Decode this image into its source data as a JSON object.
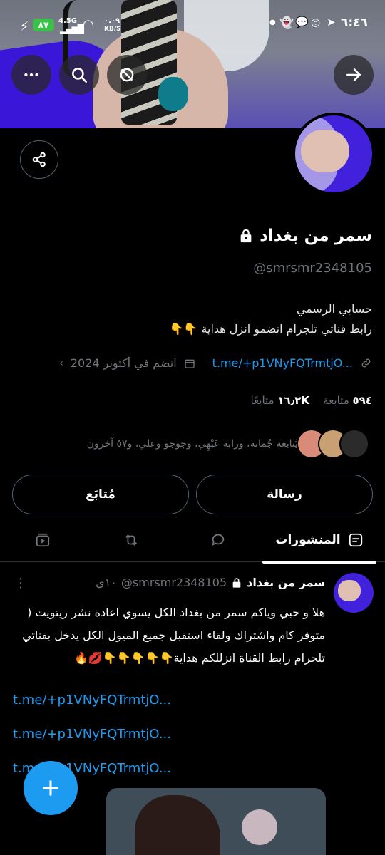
{
  "status_bar": {
    "time": "٦:٤٦",
    "battery": "٨٧",
    "network": "4.5G",
    "speed_value": "٠.٠٩",
    "speed_unit": "KB/S"
  },
  "profile": {
    "name": "سمر من بغداد",
    "handle": "@smrsmr2348105",
    "bio_line1": "حسابي الرسمي",
    "bio_line2": "رابط قناتي تلجرام انضمو انزل هداية",
    "bio_emojis": "👇👇",
    "link": "t.me/+p1VNyFQTrmtjO...",
    "joined": "انضم في أكتوبر 2024",
    "following_count": "٥٩٤",
    "following_label": "متابعة",
    "followers_count": "١٦٫٢K",
    "followers_label": "متابعًا",
    "followed_by": "يُتابعه جُمانة، ورابة عَبْهِي، وجوجو وعلي، و٥٧ آخرون"
  },
  "actions": {
    "message": "رسالة",
    "following": "مُتابَع"
  },
  "tabs": {
    "posts": "المنشورات"
  },
  "post": {
    "author": "سمر من بغداد",
    "handle": "@smrsmr2348105",
    "time": "١٠ي",
    "text": "هلا و حبي وياكم سمر من بغداد الكل يسوي اعادة نشر ريتويت ( متوفر كام واشتراك ولقاء استقبل جميع الميول الكل يدخل بقناتي تلجرام رابط القناة انزللكم هداية👇👇👇👇👇💋🔥",
    "links": [
      "t.me/+p1VNyFQTrmtjO...",
      "t.me/+p1VNyFQTrmtjO...",
      "t.me/+p1VNyFQTrmtjO..."
    ]
  },
  "colors": {
    "accent": "#1d9bf0",
    "muted": "#71767b",
    "border": "#536471"
  }
}
